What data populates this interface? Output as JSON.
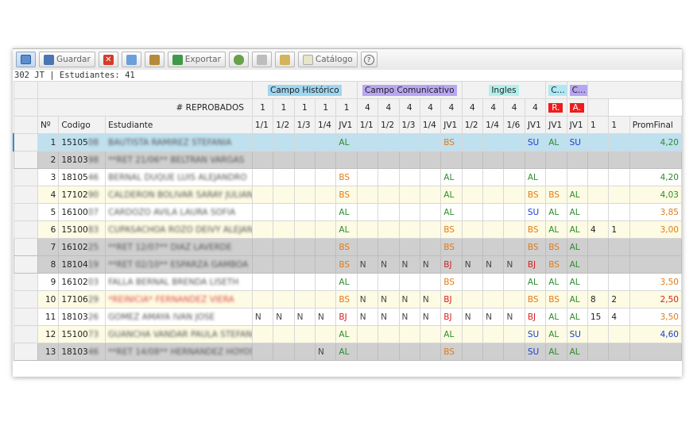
{
  "toolbar": {
    "guardar": "Guardar",
    "exportar": "Exportar",
    "catalogo": "Catálogo",
    "help": "?"
  },
  "status": "302 JT | Estudiantes: 41",
  "groups": {
    "hist": "Campo Histórico",
    "com": "Campo Comunicativo",
    "ing": "Ingles",
    "c1": "C...",
    "c2": "C...",
    "r": "R.",
    "a": "A."
  },
  "colors": {
    "hist": "#9fd6f0",
    "com": "#b8a6f2",
    "ing": "#b3f0ec",
    "c1": "#aee8f5",
    "c2": "#b7a5f0",
    "r": "#ee1c1c",
    "a": "#ee1c1c"
  },
  "header": {
    "reprobados": "# REPROBADOS",
    "counts": [
      "1",
      "1",
      "1",
      "1",
      "1",
      "4",
      "4",
      "4",
      "4",
      "4",
      "4",
      "4",
      "4",
      "4"
    ],
    "cols": [
      "Nº",
      "Codigo",
      "Estudiante",
      "1/1",
      "1/2",
      "1/3",
      "1/4",
      "JV1",
      "1/1",
      "1/2",
      "1/3",
      "1/4",
      "JV1",
      "1/2",
      "1/4",
      "1/6",
      "JV1",
      "JV1",
      "JV1",
      "1",
      "1",
      "PromFinal"
    ]
  },
  "rows": [
    {
      "n": "1",
      "cod": "15105",
      "codb": "08",
      "name": "BAUTISTA RAMIREZ STEFANIA",
      "st": "sel",
      "g": [
        "",
        "",
        "",
        "",
        "AL",
        "",
        "",
        "",
        "",
        "BS",
        "",
        "",
        "",
        "SU",
        "AL",
        "SU",
        "",
        ""
      ],
      "prom": "4,20",
      "pc": "gv"
    },
    {
      "n": "2",
      "cod": "18103",
      "codb": "98",
      "name": "**RET 21/06** BELTRAN VARGAS",
      "st": "gry",
      "g": [
        "",
        "",
        "",
        "",
        "",
        "",
        "",
        "",
        "",
        "",
        "",
        "",
        "",
        "",
        "",
        "",
        "",
        ""
      ],
      "prom": "",
      "pc": ""
    },
    {
      "n": "3",
      "cod": "18105",
      "codb": "46",
      "name": "BERNAL DUQUE LUIS ALEJANDRO",
      "st": "wht",
      "g": [
        "",
        "",
        "",
        "",
        "BS",
        "",
        "",
        "",
        "",
        "AL",
        "",
        "",
        "",
        "AL",
        "",
        "",
        "",
        ""
      ],
      "prom": "4,20",
      "pc": "gv"
    },
    {
      "n": "4",
      "cod": "17102",
      "codb": "90",
      "name": "CALDERON BOLIVAR SARAY JULIANA",
      "st": "yel",
      "g": [
        "",
        "",
        "",
        "",
        "BS",
        "",
        "",
        "",
        "",
        "AL",
        "",
        "",
        "",
        "BS",
        "BS",
        "AL",
        "",
        ""
      ],
      "prom": "4,03",
      "pc": "gv"
    },
    {
      "n": "5",
      "cod": "16100",
      "codb": "07",
      "name": "CARDOZO AVILA LAURA SOFIA",
      "st": "wht",
      "g": [
        "",
        "",
        "",
        "",
        "AL",
        "",
        "",
        "",
        "",
        "AL",
        "",
        "",
        "",
        "SU",
        "AL",
        "AL",
        "",
        ""
      ],
      "prom": "3,85",
      "pc": "ov"
    },
    {
      "n": "6",
      "cod": "15100",
      "codb": "83",
      "name": "CUPASACHOA ROZO DEIVY ALEJANDRO",
      "st": "yel",
      "g": [
        "",
        "",
        "",
        "",
        "AL",
        "",
        "",
        "",
        "",
        "BS",
        "",
        "",
        "",
        "BS",
        "AL",
        "AL",
        "4",
        "1"
      ],
      "prom": "3,00",
      "pc": "ov"
    },
    {
      "n": "7",
      "cod": "16102",
      "codb": "25",
      "name": "**RET 12/07** DIAZ LAVERDE",
      "st": "gry",
      "g": [
        "",
        "",
        "",
        "",
        "BS",
        "",
        "",
        "",
        "",
        "BS",
        "",
        "",
        "",
        "BS",
        "BS",
        "AL",
        "",
        ""
      ],
      "prom": "",
      "pc": ""
    },
    {
      "n": "8",
      "cod": "18104",
      "codb": "19",
      "name": "**RET 02/10** ESPARZA GAMBOA",
      "st": "gry",
      "g": [
        "",
        "",
        "",
        "",
        "BS",
        "N",
        "N",
        "N",
        "N",
        "BJ",
        "N",
        "N",
        "N",
        "BJ",
        "BS",
        "AL",
        "",
        ""
      ],
      "prom": "",
      "pc": ""
    },
    {
      "n": "9",
      "cod": "16102",
      "codb": "03",
      "name": "FALLA BERNAL BRENDA LISETH",
      "st": "wht",
      "g": [
        "",
        "",
        "",
        "",
        "AL",
        "",
        "",
        "",
        "",
        "BS",
        "",
        "",
        "",
        "AL",
        "AL",
        "AL",
        "",
        ""
      ],
      "prom": "3,50",
      "pc": "ov"
    },
    {
      "n": "10",
      "cod": "17106",
      "codb": "29",
      "name": "*REINICIA* FERNANDEZ VIERA",
      "st": "yel",
      "nameRed": true,
      "g": [
        "",
        "",
        "",
        "",
        "BS",
        "N",
        "N",
        "N",
        "N",
        "BJ",
        "",
        "",
        "",
        "BS",
        "BS",
        "AL",
        "8",
        "2"
      ],
      "prom": "2,50",
      "pc": "rv"
    },
    {
      "n": "11",
      "cod": "18103",
      "codb": "26",
      "name": "GOMEZ AMAYA IVAN JOSE",
      "st": "wht",
      "g": [
        "N",
        "N",
        "N",
        "N",
        "BJ",
        "N",
        "N",
        "N",
        "N",
        "BJ",
        "N",
        "N",
        "N",
        "BJ",
        "AL",
        "AL",
        "15",
        "4"
      ],
      "prom": "3,50",
      "pc": "ov"
    },
    {
      "n": "12",
      "cod": "15100",
      "codb": "73",
      "name": "GUANCHA VANDAR PAULA STEFANIA",
      "st": "yel",
      "g": [
        "",
        "",
        "",
        "",
        "AL",
        "",
        "",
        "",
        "",
        "AL",
        "",
        "",
        "",
        "SU",
        "AL",
        "SU",
        "",
        ""
      ],
      "prom": "4,60",
      "pc": "bv"
    },
    {
      "n": "13",
      "cod": "18103",
      "codb": "46",
      "name": "**RET 14/08** HERNANDEZ HOYOS",
      "st": "gry",
      "g": [
        "",
        "",
        "",
        "N",
        "AL",
        "",
        "",
        "",
        "",
        "BS",
        "",
        "",
        "",
        "SU",
        "AL",
        "AL",
        "",
        ""
      ],
      "prom": "",
      "pc": ""
    }
  ]
}
